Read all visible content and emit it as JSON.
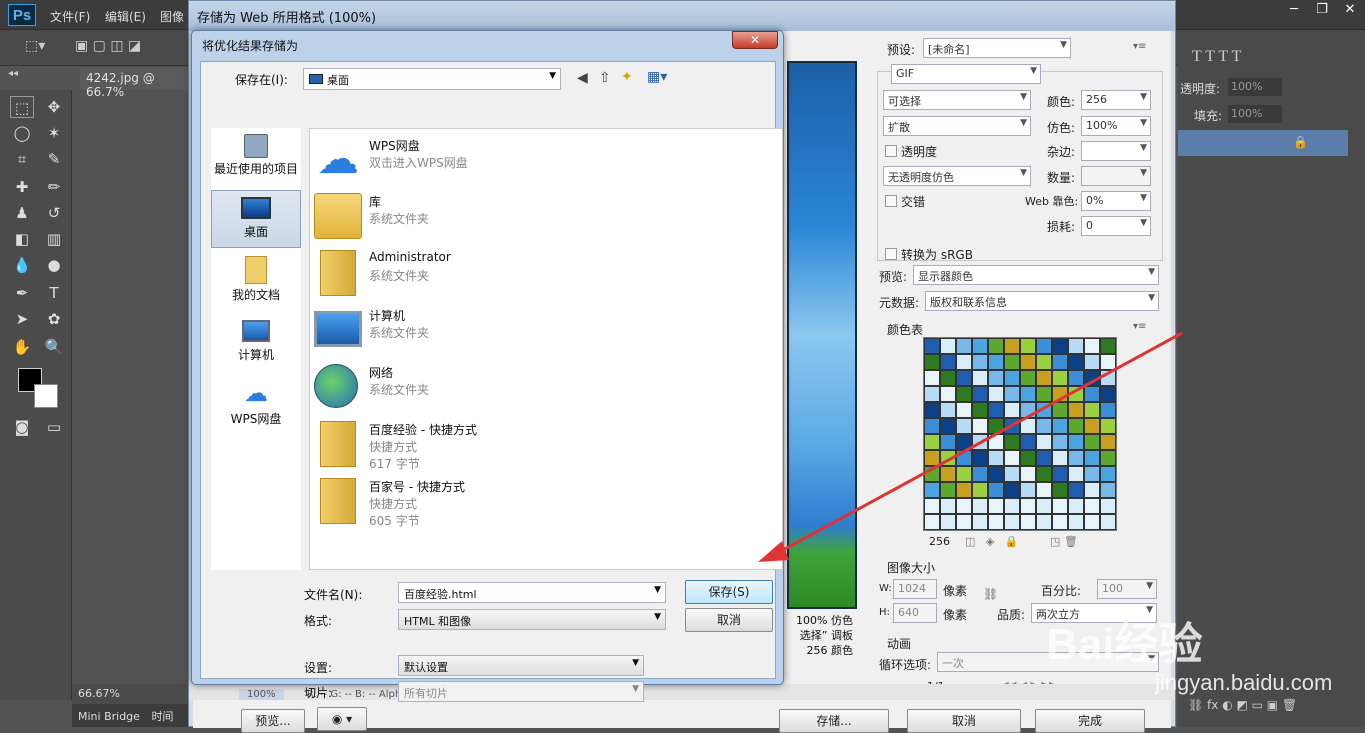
{
  "ps": {
    "menus": [
      "文件(F)",
      "编辑(E)",
      "图像"
    ],
    "doc_tab": "4242.jpg @ 66.7%",
    "zoom": "66.67%",
    "bottom_tabs": [
      "Mini Bridge",
      "时间"
    ],
    "right_opacity_label": "透明度:",
    "right_opacity_value": "100%",
    "right_fill_label": "填充:",
    "right_fill_value": "100%"
  },
  "sfw": {
    "title": "存储为 Web 所用格式 (100%)",
    "preset_label": "预设:",
    "preset_value": "[未命名]",
    "format": "GIF",
    "reduction": "可选择",
    "colors_label": "颜色:",
    "colors_value": "256",
    "dither_algo": "扩散",
    "dither_label": "仿色:",
    "dither_value": "100%",
    "transparency_label": "透明度",
    "matte_label": "杂边:",
    "trans_dither": "无透明度仿色",
    "amount_label": "数量:",
    "interlaced_label": "交错",
    "websnap_label": "Web 靠色:",
    "websnap_value": "0%",
    "lossy_label": "损耗:",
    "lossy_value": "0",
    "srgb_label": "转换为 sRGB",
    "preview_label": "预览:",
    "preview_value": "显示器颜色",
    "metadata_label": "元数据:",
    "metadata_value": "版权和联系信息",
    "colortable_label": "颜色表",
    "color_count": "256",
    "imagesize_label": "图像大小",
    "w_label": "W:",
    "w_value": "1024",
    "h_label": "H:",
    "h_value": "640",
    "px_label": "像素",
    "percent_label": "百分比:",
    "percent_value": "100",
    "quality_label": "品质:",
    "quality_value": "两次立方",
    "anim_label": "动画",
    "loop_label": "循环选项:",
    "loop_value": "一次",
    "frame_counter": "1/1",
    "preview_info": [
      "100% 仿色",
      "选择” 调板",
      "256 颜色"
    ],
    "status_zoom": "100%",
    "status_text": "R: --   G: --   B: --      Alpha: --    十六进制: --         索引: --",
    "btn_preview": "预览...",
    "btn_save": "存储...",
    "btn_cancel": "取消",
    "btn_done": "完成"
  },
  "dialog": {
    "title": "将优化结果存储为",
    "close": "✕",
    "savein_label": "保存在(I):",
    "savein_value": "桌面",
    "places": [
      "最近使用的项目",
      "桌面",
      "我的文档",
      "计算机",
      "WPS网盘"
    ],
    "files": [
      {
        "name": "WPS网盘",
        "sub": "双击进入WPS网盘",
        "size": ""
      },
      {
        "name": "库",
        "sub": "系统文件夹",
        "size": ""
      },
      {
        "name": "Administrator",
        "sub": "系统文件夹",
        "size": ""
      },
      {
        "name": "计算机",
        "sub": "系统文件夹",
        "size": ""
      },
      {
        "name": "网络",
        "sub": "系统文件夹",
        "size": ""
      },
      {
        "name": "百度经验 - 快捷方式",
        "sub": "快捷方式",
        "size": "617 字节"
      },
      {
        "name": "百家号 - 快捷方式",
        "sub": "快捷方式",
        "size": "605 字节"
      }
    ],
    "filename_label": "文件名(N):",
    "filename_value": "百度经验.html",
    "format_label": "格式:",
    "format_value": "HTML 和图像",
    "save_btn": "保存(S)",
    "cancel_btn": "取消",
    "settings_label": "设置:",
    "settings_value": "默认设置",
    "slices_label": "切片:",
    "slices_value": "所有切片"
  },
  "watermark": {
    "brand": "Bai经验",
    "url": "jingyan.baidu.com"
  },
  "colors": {
    "accent": "#3a6ea5",
    "arrow": "#e03434"
  }
}
